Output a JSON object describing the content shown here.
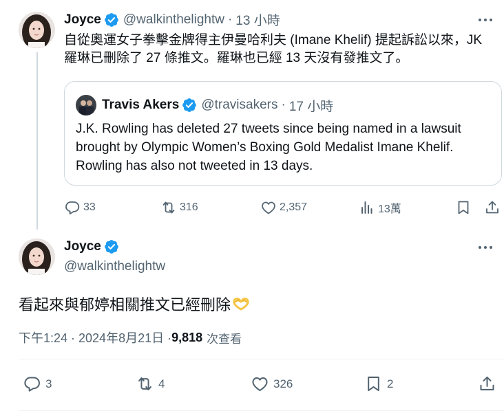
{
  "tweet1": {
    "author_name": "Joyce",
    "handle": "@walkinthelightw",
    "separator": "·",
    "time": "13 小時",
    "text": "自從奧運女子拳擊金牌得主伊曼哈利夫 (Imane Khelif) 提起訴訟以來，JK 羅琳已刪除了 27 條推文。羅琳也已經 13 天沒有發推文了。",
    "quote": {
      "author_name": "Travis Akers",
      "handle": "@travisakers",
      "separator": "·",
      "time": "17 小時",
      "text": "J.K. Rowling has deleted 27 tweets since being named in a lawsuit brought by Olympic Women’s Boxing Gold Medalist Imane Khelif. Rowling has also not tweeted in 13 days."
    },
    "actions": {
      "replies": "33",
      "reposts": "316",
      "likes": "2,357",
      "views": "13萬"
    }
  },
  "tweet2": {
    "author_name": "Joyce",
    "handle": "@walkinthelightw",
    "text": "看起來與郁婷相關推文已經刪除",
    "timestamp": "下午1:24 · 2024年8月21日 · ",
    "views_count": "9,818",
    "views_label": "次查看",
    "actions": {
      "replies": "3",
      "reposts": "4",
      "likes": "326",
      "bookmarks": "2"
    }
  },
  "colors": {
    "verified": "#1d9bf0",
    "muted": "#536471",
    "border": "#cfd9de",
    "text": "#0f1419"
  },
  "icons": [
    "verified-badge-icon",
    "more-icon",
    "reply-icon",
    "repost-icon",
    "like-icon",
    "views-icon",
    "bookmark-icon",
    "share-icon",
    "heart-hands-emoji"
  ]
}
